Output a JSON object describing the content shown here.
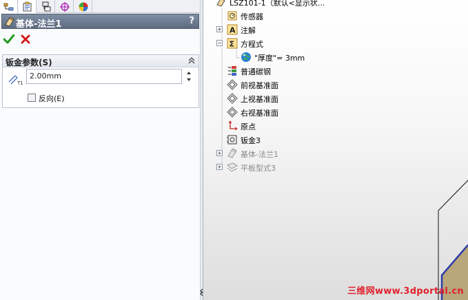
{
  "property_manager": {
    "title": "基体-法兰1",
    "help": "?",
    "group_title": "钣金参数(S)",
    "thickness_value": "2.00mm",
    "reverse_label": "反向(E)",
    "reverse_checked": false
  },
  "tree": {
    "top_label": "LSZ101-1（默认<显示状...",
    "items": [
      {
        "label": "传感器"
      },
      {
        "label": "注解"
      },
      {
        "label": "方程式"
      },
      {
        "label": "\"厚度\"= 3mm"
      },
      {
        "label": "普通碳钢"
      },
      {
        "label": "前视基准面"
      },
      {
        "label": "上视基准面"
      },
      {
        "label": "右视基准面"
      },
      {
        "label": "原点"
      },
      {
        "label": "钣金3"
      },
      {
        "label": "基体-法兰1"
      },
      {
        "label": "平板型式3"
      }
    ]
  },
  "watermark": "三维网www.3dportal.cn",
  "colors": {
    "header": "#5e6c82",
    "ok": "#1f9a1f",
    "cancel": "#d21b1b",
    "model_face": "#b7a779",
    "model_edge": "#2b3ba8"
  }
}
